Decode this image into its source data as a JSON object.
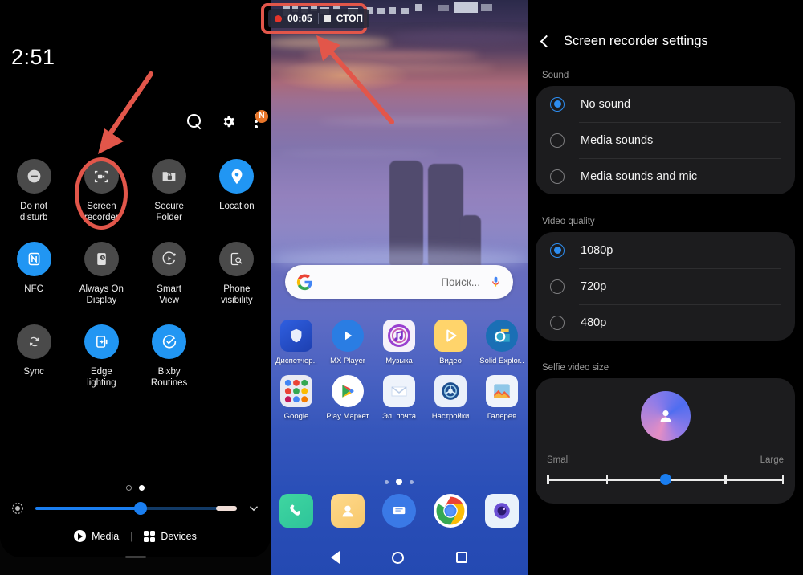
{
  "left_panel": {
    "clock": "2:51",
    "top_icons": [
      {
        "name": "search-icon",
        "label": "Search"
      },
      {
        "name": "gear-icon",
        "label": "Settings"
      },
      {
        "name": "more-options-icon",
        "label": "More options"
      }
    ],
    "badge_letter": "N",
    "tiles": [
      {
        "label": "Do not\ndisturb",
        "label_l1": "Do not",
        "label_l2": "disturb",
        "icon": "do-not-disturb-icon",
        "active": false
      },
      {
        "label": "Screen\nrecorder",
        "label_l1": "Screen",
        "label_l2": "recorder",
        "icon": "screen-recorder-icon",
        "active": false,
        "highlighted": true
      },
      {
        "label": "Secure\nFolder",
        "label_l1": "Secure",
        "label_l2": "Folder",
        "icon": "secure-folder-icon",
        "active": false
      },
      {
        "label": "Location",
        "label_l1": "Location",
        "label_l2": "",
        "icon": "location-pin-icon",
        "active": true
      },
      {
        "label": "NFC",
        "label_l1": "NFC",
        "label_l2": "",
        "icon": "nfc-icon",
        "active": true
      },
      {
        "label": "Always On\nDisplay",
        "label_l1": "Always On",
        "label_l2": "Display",
        "icon": "always-on-display-icon",
        "active": false
      },
      {
        "label": "Smart\nView",
        "label_l1": "Smart",
        "label_l2": "View",
        "icon": "smart-view-icon",
        "active": false
      },
      {
        "label": "Phone\nvisibility",
        "label_l1": "Phone",
        "label_l2": "visibility",
        "icon": "phone-visibility-icon",
        "active": false
      },
      {
        "label": "Sync",
        "label_l1": "Sync",
        "label_l2": "",
        "icon": "sync-icon",
        "active": false
      },
      {
        "label": "Edge\nlighting",
        "label_l1": "Edge",
        "label_l2": "lighting",
        "icon": "edge-lighting-icon",
        "active": true
      },
      {
        "label": "Bixby\nRoutines",
        "label_l1": "Bixby",
        "label_l2": "Routines",
        "icon": "bixby-routines-icon",
        "active": true
      }
    ],
    "page_dots": {
      "count": 2,
      "active_index": 1
    },
    "brightness": {
      "value_percent": 52,
      "icon": "brightness-icon",
      "expand_icon": "chevron-down-icon"
    },
    "footer": {
      "media_label": "Media",
      "devices_label": "Devices",
      "separator": "|"
    },
    "accent_color": "#1a7ef0",
    "annotation_color": "#e2564a"
  },
  "middle_panel": {
    "recording_chip": {
      "time": "00:05",
      "stop_label": "СТОП",
      "record_dot_color": "#e5342a"
    },
    "search_bar": {
      "placeholder": "Поиск...",
      "logo": "google-logo-icon",
      "mic": "microphone-icon"
    },
    "apps_row1": [
      {
        "label": "Диспетчер..",
        "icon": "security-manager-icon"
      },
      {
        "label": "MX Player",
        "icon": "mx-player-icon"
      },
      {
        "label": "Музыка",
        "icon": "music-icon"
      },
      {
        "label": "Видео",
        "icon": "video-icon"
      },
      {
        "label": "Solid Explor..",
        "icon": "solid-explorer-icon"
      }
    ],
    "apps_row2": [
      {
        "label": "Google",
        "icon": "google-folder-icon"
      },
      {
        "label": "Play Маркет",
        "icon": "play-store-icon"
      },
      {
        "label": "Эл. почта",
        "icon": "email-icon"
      },
      {
        "label": "Настройки",
        "icon": "settings-icon"
      },
      {
        "label": "Галерея",
        "icon": "gallery-icon"
      }
    ],
    "dock": [
      {
        "label": "Phone",
        "icon": "phone-icon"
      },
      {
        "label": "Contacts",
        "icon": "contacts-icon"
      },
      {
        "label": "Messages",
        "icon": "messages-icon"
      },
      {
        "label": "Chrome",
        "icon": "chrome-icon"
      },
      {
        "label": "Camera",
        "icon": "camera-icon"
      }
    ],
    "page_dots": {
      "count": 3,
      "active_index": 1
    },
    "navbar": [
      {
        "name": "nav-back-button",
        "icon": "back-triangle-icon"
      },
      {
        "name": "nav-home-button",
        "icon": "home-circle-icon"
      },
      {
        "name": "nav-recents-button",
        "icon": "recents-square-icon"
      }
    ]
  },
  "right_panel": {
    "title": "Screen recorder settings",
    "back_icon": "back-chevron-icon",
    "sections": [
      {
        "label": "Sound",
        "options": [
          {
            "label": "No sound",
            "selected": true
          },
          {
            "label": "Media sounds",
            "selected": false
          },
          {
            "label": "Media sounds and mic",
            "selected": false
          }
        ]
      },
      {
        "label": "Video quality",
        "options": [
          {
            "label": "1080p",
            "selected": true
          },
          {
            "label": "720p",
            "selected": false
          },
          {
            "label": "480p",
            "selected": false
          }
        ]
      }
    ],
    "selfie": {
      "label": "Selfie video size",
      "small_label": "Small",
      "large_label": "Large",
      "value_percent": 50,
      "avatar_icon": "person-avatar-icon"
    },
    "accent_color": "#2d8df0"
  }
}
